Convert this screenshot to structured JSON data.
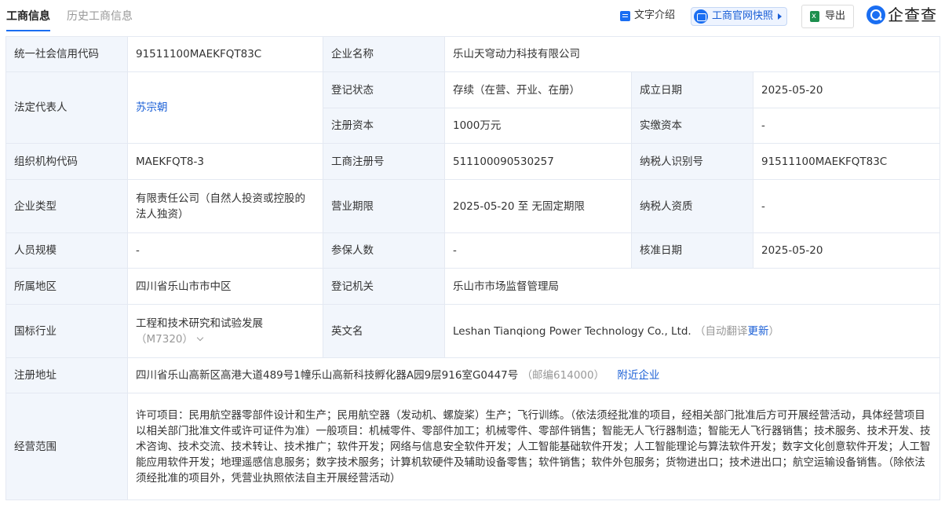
{
  "tabs": {
    "active": "工商信息",
    "inactive": "历史工商信息"
  },
  "toolbar": {
    "intro": "文字介绍",
    "snapshot": "工商官网快照",
    "export": "导出",
    "logo": "企查查"
  },
  "table": {
    "credit_code_label": "统一社会信用代码",
    "credit_code": "91511100MAEKFQT83C",
    "company_name_label": "企业名称",
    "company_name": "乐山天穹动力科技有限公司",
    "legal_rep_label": "法定代表人",
    "legal_rep": "苏宗朝",
    "reg_status_label": "登记状态",
    "reg_status": "存续（在营、开业、在册）",
    "founded_label": "成立日期",
    "founded": "2025-05-20",
    "reg_capital_label": "注册资本",
    "reg_capital": "1000万元",
    "paid_capital_label": "实缴资本",
    "paid_capital": "-",
    "org_code_label": "组织机构代码",
    "org_code": "MAEKFQT8-3",
    "reg_no_label": "工商注册号",
    "reg_no": "511100090530257",
    "taxpayer_id_label": "纳税人识别号",
    "taxpayer_id": "91511100MAEKFQT83C",
    "company_type_label": "企业类型",
    "company_type": "有限责任公司（自然人投资或控股的法人独资）",
    "term_label": "营业期限",
    "term": "2025-05-20 至 无固定期限",
    "tax_qual_label": "纳税人资质",
    "tax_qual": "-",
    "staff_label": "人员规模",
    "staff": "-",
    "insured_label": "参保人数",
    "insured": "-",
    "approved_label": "核准日期",
    "approved": "2025-05-20",
    "region_label": "所属地区",
    "region": "四川省乐山市市中区",
    "authority_label": "登记机关",
    "authority": "乐山市市场监督管理局",
    "industry_label": "国标行业",
    "industry": "工程和技术研究和试验发展",
    "industry_code": "（M7320）",
    "english_label": "英文名",
    "english_name": "Leshan Tianqiong Power Technology Co., Ltd.",
    "auto_translate": "（自动翻译",
    "update_link": "更新",
    "auto_translate_close": "）",
    "address_label": "注册地址",
    "address": "四川省乐山高新区高港大道489号1幢乐山高新科技孵化器A园9层916室G0447号",
    "postcode": "（邮编614000）",
    "nearby_link": "附近企业",
    "scope_label": "经营范围",
    "scope": "许可项目：民用航空器零部件设计和生产；民用航空器（发动机、螺旋桨）生产；飞行训练。（依法须经批准的项目，经相关部门批准后方可开展经营活动，具体经营项目以相关部门批准文件或许可证件为准）一般项目：机械零件、零部件加工；机械零件、零部件销售；智能无人飞行器制造；智能无人飞行器销售；技术服务、技术开发、技术咨询、技术交流、技术转让、技术推广；软件开发；网络与信息安全软件开发；人工智能基础软件开发；人工智能理论与算法软件开发；数字文化创意软件开发；人工智能应用软件开发；地理遥感信息服务；数字技术服务；计算机软硬件及辅助设备零售；软件销售；软件外包服务；货物进出口；技术进出口；航空运输设备销售。（除依法须经批准的项目外，凭营业执照依法自主开展经营活动）"
  }
}
